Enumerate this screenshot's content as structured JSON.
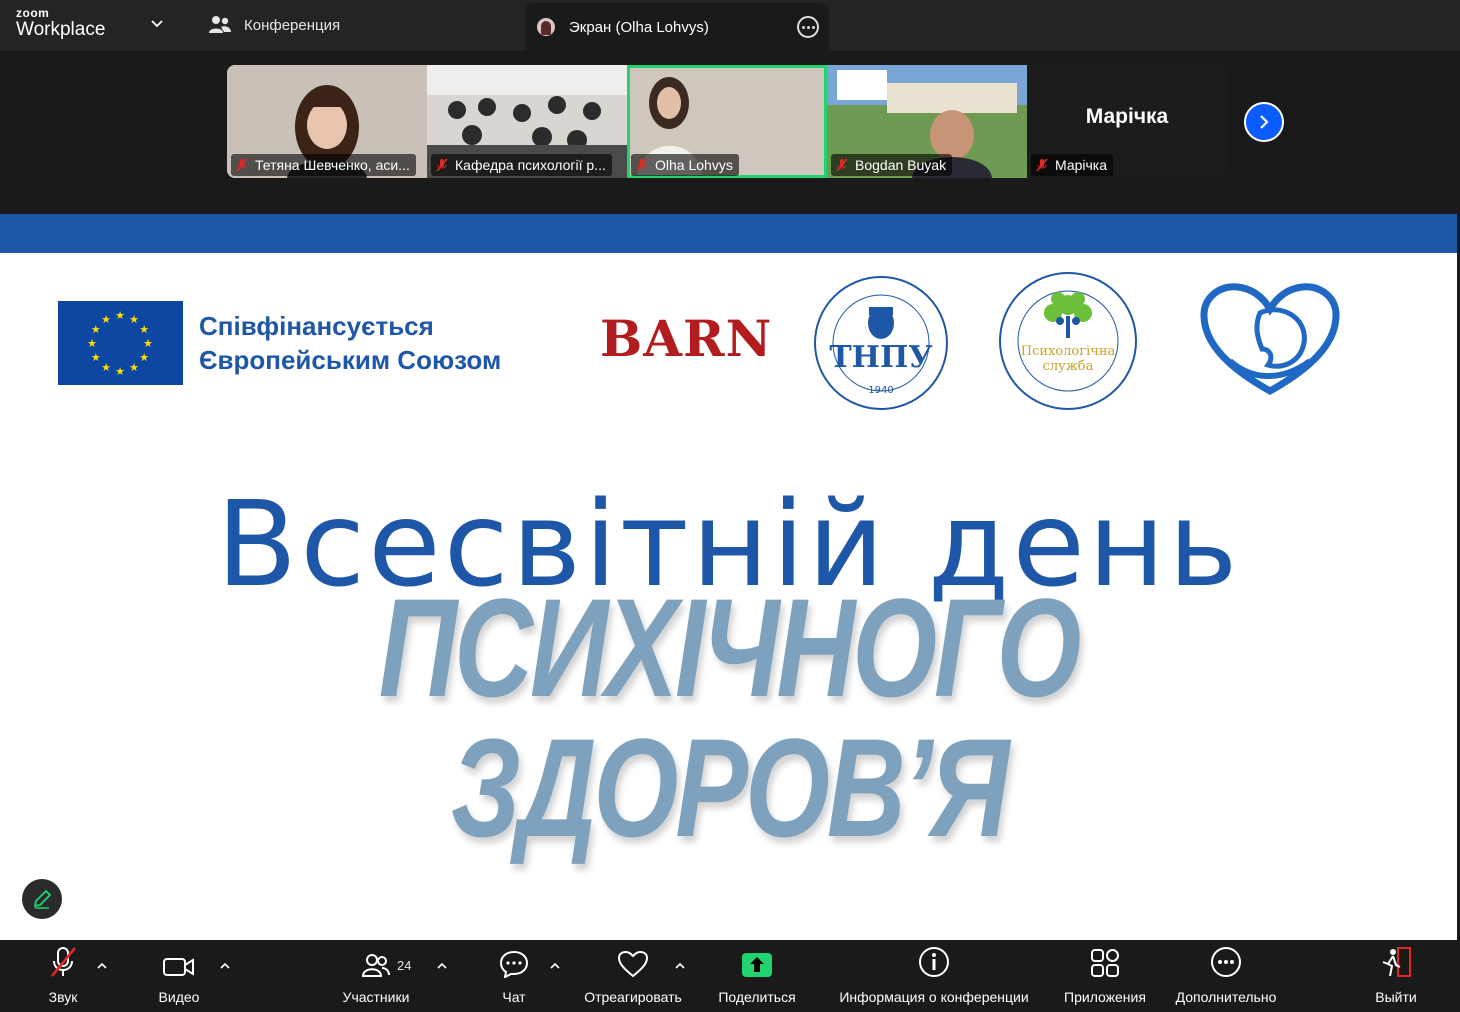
{
  "app": {
    "brand_small": "zoom",
    "brand_name": "Workplace"
  },
  "tabs": {
    "meeting_label": "Конференция",
    "screen_label": "Экран (Olha Lohvys)"
  },
  "participants_strip": [
    {
      "name": "Тетяна Шевченко, аси...",
      "muted": true
    },
    {
      "name": "Кафедра психології р...",
      "muted": true
    },
    {
      "name": "Olha Lohvys",
      "muted": true,
      "active_speaker": true
    },
    {
      "name": "Bogdan Buyak",
      "muted": true
    },
    {
      "name": "Марічка",
      "muted": true,
      "display_name_large": "Марічка"
    }
  ],
  "slide": {
    "eu_line1": "Співфінансується",
    "eu_line2": "Європейським Союзом",
    "barn_logo": "BARN",
    "tnpu_seal": {
      "ring_text": "ТЕРНОПІЛЬСЬКИЙ НАЦІОНАЛЬНИЙ ПЕДАГОГІЧНИЙ УНІВЕРСИТЕТ ІМЕНІ ВОЛОДИМИРА ГНАТЮКА",
      "abbr": "ТНПУ",
      "year": "1940"
    },
    "psych_seal": {
      "ring_text": "ТЕРНОПІЛЬСЬКИЙ НАЦІОНАЛЬНИЙ ПЕДАГОГІЧНИЙ УНІВЕРСИТЕТ ІМЕНІ ВОЛОДИМИРА ГНАТЮКА",
      "line1": "Психологічна",
      "line2": "служба"
    },
    "title_line1": "Всесвітній день",
    "title_line2": "ПСИХІЧНОГО",
    "title_line3": "ЗДОРОВ’Я"
  },
  "toolbar": {
    "audio": "Звук",
    "video": "Видео",
    "participants": "Участники",
    "participants_count": "24",
    "chat": "Чат",
    "react": "Отреагировать",
    "share": "Поделиться",
    "info": "Информация о конференции",
    "apps": "Приложения",
    "more": "Дополнительно",
    "leave": "Выйти"
  },
  "colors": {
    "accent_blue": "#0b5cff",
    "share_green": "#23d36f",
    "slide_blue": "#1f57a8",
    "slide_light_blue": "#7ea2bd",
    "leave_red": "#e02828"
  }
}
